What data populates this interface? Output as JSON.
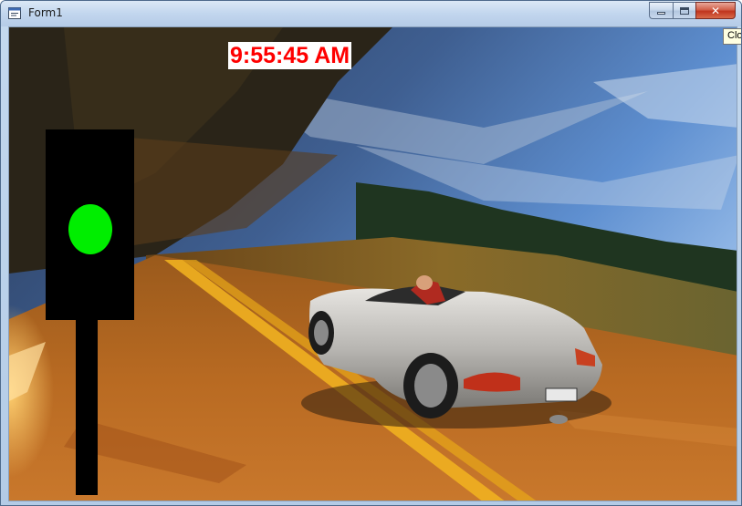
{
  "window": {
    "title": "Form1",
    "controls": {
      "minimize": "minimize",
      "maximize": "maximize",
      "close": "✕"
    }
  },
  "tooltip": {
    "text": "Close"
  },
  "form": {
    "clock_text": "9:55:45 AM",
    "clock_color": "#ff0000",
    "traffic_light": {
      "active_color": "green",
      "light_color": "#00ee00"
    },
    "background_image": "Silver convertible sports car driving on a motion-blurred road at sunset"
  }
}
